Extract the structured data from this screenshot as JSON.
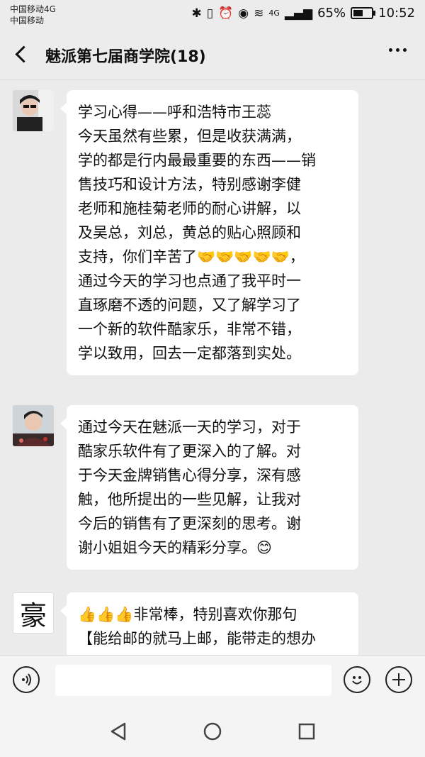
{
  "status_bar": {
    "carrier1": "中国移动4G",
    "carrier2": "中国移动",
    "network": "4G",
    "battery": "65%",
    "battery_level": 0.65,
    "time": "10:52"
  },
  "header": {
    "title": "魅派第七届商学院(18)"
  },
  "messages": [
    {
      "lines": [
        "学习心得——呼和浩特市王蕊",
        "今天虽然有些累，但是收获满满，",
        "学的都是行内最最重要的东西——销",
        "售技巧和设计方法，特别感谢李健",
        "老师和施桂菊老师的耐心讲解，以",
        "及吴总，刘总，黄总的贴心照顾和",
        "支持，你们辛苦了🤝🤝🤝🤝🤝，",
        "通过今天的学习也点通了我平时一",
        "直琢磨不透的问题，又了解学习了",
        "一个新的软件酷家乐，非常不错，",
        "学以致用，回去一定都落到实处。"
      ]
    },
    {
      "lines": [
        "通过今天在魅派一天的学习，对于",
        "酷家乐软件有了更深入的了解。对",
        "于今天金牌销售心得分享，深有感",
        "触，他所提出的一些见解，让我对",
        "今后的销售有了更深刻的思考。谢",
        "谢小姐姐今天的精彩分享。😊"
      ]
    },
    {
      "avatar_text": "豪",
      "lines": [
        "👍👍👍非常棒，特别喜欢你那句",
        "【能给邮的就马上邮，能带走的想办"
      ]
    }
  ],
  "input_bar": {
    "voice_icon": "voice-icon",
    "emoji_icon": "smiley-icon",
    "plus_icon": "plus-icon"
  },
  "nav_bar": {
    "back": "triangle-back-icon",
    "home": "circle-home-icon",
    "recents": "square-recents-icon"
  }
}
